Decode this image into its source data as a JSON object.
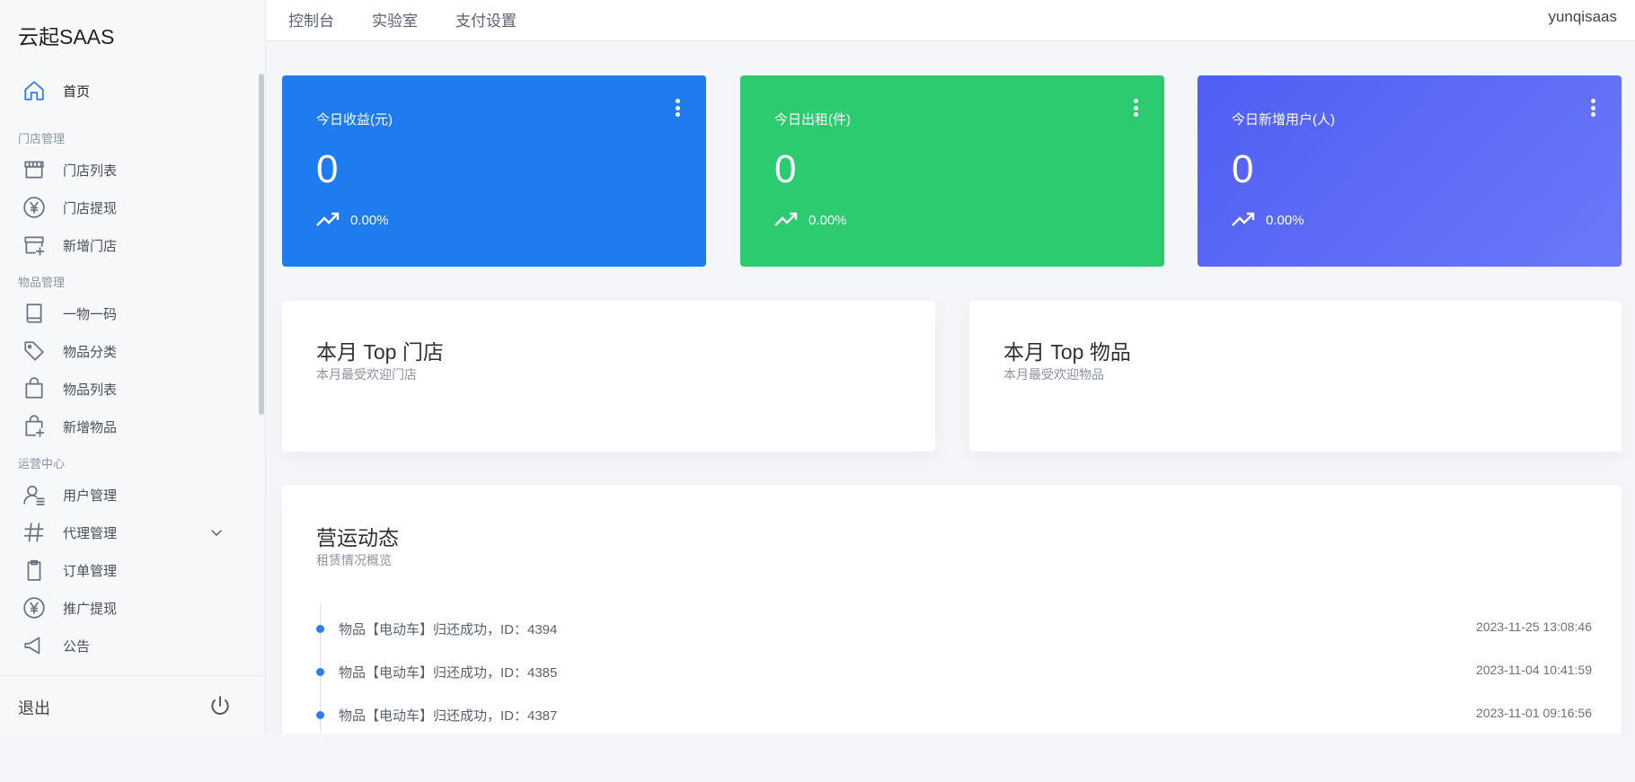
{
  "brand": "云起SAAS",
  "topnav": [
    "控制台",
    "实验室",
    "支付设置"
  ],
  "user": "yunqisaas",
  "sidebar": {
    "home": {
      "label": "首页",
      "icon": "home-icon"
    },
    "groups": [
      {
        "title": "门店管理",
        "items": [
          {
            "label": "门店列表",
            "icon": "store-icon"
          },
          {
            "label": "门店提现",
            "icon": "yen-circle-icon"
          },
          {
            "label": "新增门店",
            "icon": "store-add-icon"
          }
        ]
      },
      {
        "title": "物品管理",
        "items": [
          {
            "label": "一物一码",
            "icon": "book-icon"
          },
          {
            "label": "物品分类",
            "icon": "tag-icon"
          },
          {
            "label": "物品列表",
            "icon": "bag-icon"
          },
          {
            "label": "新增物品",
            "icon": "bag-add-icon"
          }
        ]
      },
      {
        "title": "运营中心",
        "items": [
          {
            "label": "用户管理",
            "icon": "user-list-icon"
          },
          {
            "label": "代理管理",
            "icon": "hash-icon"
          },
          {
            "label": "订单管理",
            "icon": "clipboard-icon"
          },
          {
            "label": "推广提现",
            "icon": "yen-circle-icon"
          },
          {
            "label": "公告",
            "icon": "megaphone-icon"
          }
        ]
      }
    ],
    "logout": "退出"
  },
  "stats": [
    {
      "title": "今日收益(元)",
      "value": "0",
      "trend": "0.00%"
    },
    {
      "title": "今日出租(件)",
      "value": "0",
      "trend": "0.00%"
    },
    {
      "title": "今日新增用户(人)",
      "value": "0",
      "trend": "0.00%"
    }
  ],
  "panels": {
    "top_store": {
      "title": "本月 Top 门店",
      "subtitle": "本月最受欢迎门店"
    },
    "top_item": {
      "title": "本月 Top 物品",
      "subtitle": "本月最受欢迎物品"
    },
    "activity": {
      "title": "营运动态",
      "subtitle": "租赁情况概览",
      "events": [
        {
          "text": "物品【电动车】归还成功，ID：4394",
          "time": "2023-11-25 13:08:46"
        },
        {
          "text": "物品【电动车】归还成功，ID：4385",
          "time": "2023-11-04 10:41:59"
        },
        {
          "text": "物品【电动车】归还成功，ID：4387",
          "time": "2023-11-01 09:16:56"
        }
      ]
    }
  },
  "colors": {
    "accent": "#2b7bf3",
    "blue_card": "#1f7bf0",
    "green_card": "#2ccb70",
    "indigo_card": "#5a67f6"
  }
}
